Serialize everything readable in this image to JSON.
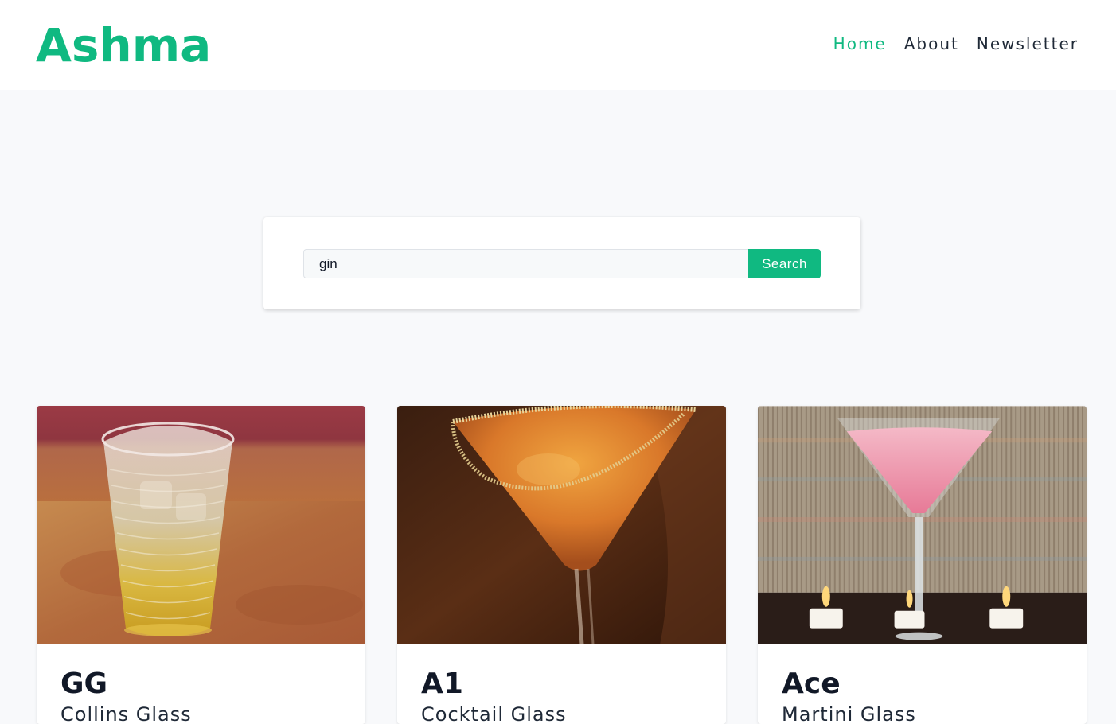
{
  "header": {
    "brand": "Ashma",
    "nav": [
      {
        "label": "Home",
        "active": true
      },
      {
        "label": "About",
        "active": false
      },
      {
        "label": "Newsletter",
        "active": false
      }
    ]
  },
  "search": {
    "value": "gin",
    "button_label": "Search"
  },
  "cards": [
    {
      "title": "GG",
      "subtitle": "Collins Glass",
      "image": "ice-tumbler-drink-photo"
    },
    {
      "title": "A1",
      "subtitle": "Cocktail Glass",
      "image": "orange-sugar-rim-cocktail-photo"
    },
    {
      "title": "Ace",
      "subtitle": "Martini Glass",
      "image": "pink-martini-candles-photo"
    }
  ],
  "colors": {
    "accent": "#10b981",
    "text": "#1f2937",
    "background": "#f8f9fb"
  }
}
